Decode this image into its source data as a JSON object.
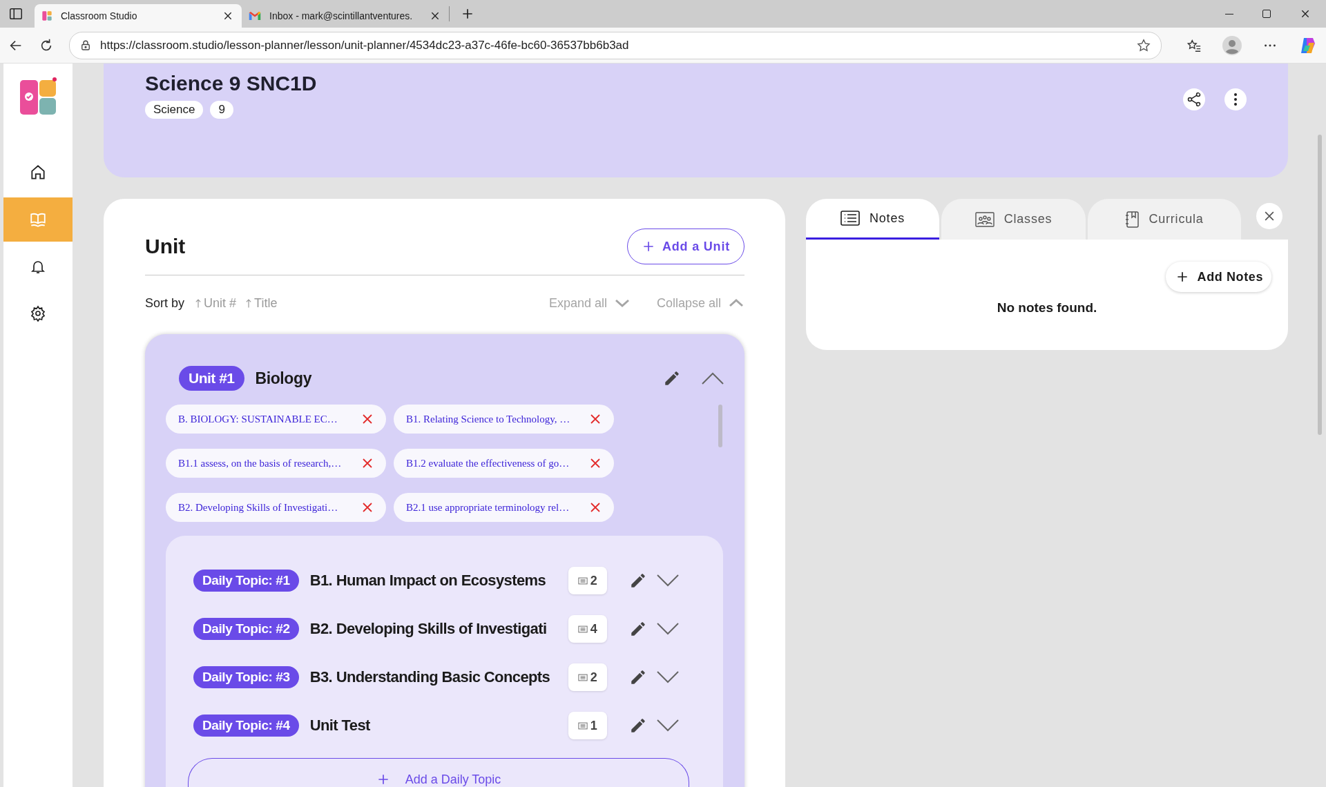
{
  "browser": {
    "tabs": [
      {
        "title": "Classroom Studio",
        "selected": true
      },
      {
        "title": "Inbox - mark@scintillantventures.",
        "selected": false
      }
    ],
    "url": "https://classroom.studio/lesson-planner/lesson/unit-planner/4534dc23-a37c-46fe-bc60-36537bb6b3ad"
  },
  "sidebar": {
    "items": [
      {
        "selected": false
      },
      {
        "selected": true
      },
      {
        "selected": false
      },
      {
        "selected": false
      }
    ]
  },
  "header": {
    "title": "Science 9 SNC1D",
    "tags": [
      "Science",
      "9"
    ]
  },
  "unit_section": {
    "title": "Unit",
    "add_button": "Add a Unit",
    "sort_label": "Sort by",
    "sort_options": [
      "Unit #",
      "Title"
    ],
    "expand_all": "Expand all",
    "collapse_all": "Collapse all",
    "units": [
      {
        "badge": "Unit #1",
        "name": "Biology",
        "expanded": true,
        "curriculum_tags": [
          "B. BIOLOGY: SUSTAINABLE EC…",
          "B1. Relating Science to Technology, …",
          "B1.1 assess, on the basis of research,…",
          "B1.2 evaluate the effectiveness of go…",
          "B2. Developing Skills of Investigati…",
          "B2.1 use appropriate terminology rel…"
        ],
        "topics": [
          {
            "badge": "Daily Topic: #1",
            "title": "B1. Human Impact on Ecosystems",
            "count": "2",
            "expanded": false
          },
          {
            "badge": "Daily Topic: #2",
            "title": "B2. Developing Skills of Investigati",
            "count": "4",
            "expanded": false
          },
          {
            "badge": "Daily Topic: #3",
            "title": "B3. Understanding Basic Concepts",
            "count": "2",
            "expanded": false
          },
          {
            "badge": "Daily Topic: #4",
            "title": "Unit Test",
            "count": "1",
            "expanded": false
          }
        ],
        "add_topic": "Add a Daily Topic"
      }
    ]
  },
  "side_panel": {
    "tabs": [
      {
        "label": "Notes",
        "selected": true
      },
      {
        "label": "Classes",
        "selected": false
      },
      {
        "label": "Curricula",
        "selected": false
      }
    ],
    "add_button": "Add Notes",
    "empty_message": "No notes found."
  }
}
